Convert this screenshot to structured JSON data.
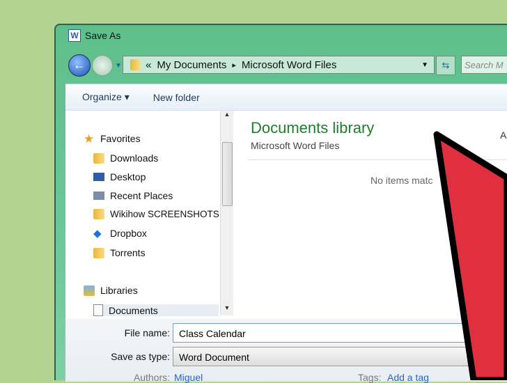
{
  "window": {
    "title": "Save As",
    "app_icon": "word-icon"
  },
  "address": {
    "prefix": "«",
    "path": [
      "My Documents",
      "Microsoft Word Files"
    ],
    "sep": "▸"
  },
  "search": {
    "placeholder": "Search M"
  },
  "toolbar": {
    "organize": "Organize ▾",
    "new_folder": "New folder"
  },
  "sidebar": {
    "favorites": "Favorites",
    "items": [
      "Downloads",
      "Desktop",
      "Recent Places",
      "Wikihow SCREENSHOTS",
      "Dropbox",
      "Torrents"
    ],
    "libraries": "Libraries",
    "lib_items": [
      "Documents"
    ]
  },
  "main": {
    "title": "Documents library",
    "subtitle": "Microsoft Word Files",
    "arrange": "A",
    "empty": "No items matc"
  },
  "form": {
    "file_name_label": "File name:",
    "file_name": "Class Calendar",
    "type_label": "Save as type:",
    "type": "Word Document",
    "authors_label": "Authors:",
    "authors": "Miguel",
    "tags_label": "Tags:",
    "tags": "Add a tag"
  },
  "colors": {
    "arrow": "#e03040",
    "frame": "#6cc79a"
  }
}
